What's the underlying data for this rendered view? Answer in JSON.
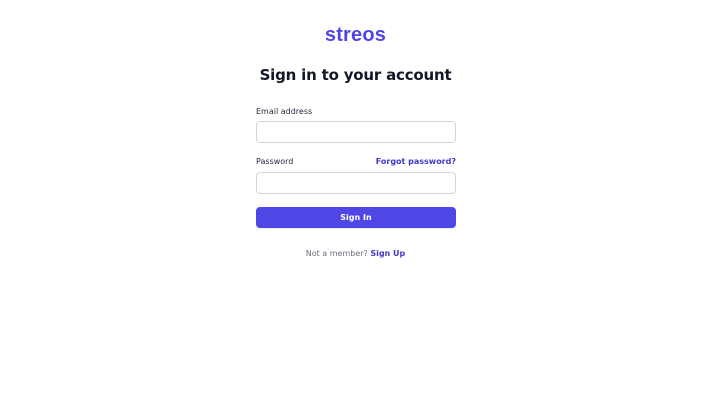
{
  "brand": {
    "name": "streos"
  },
  "heading": {
    "title": "Sign in to your account"
  },
  "form": {
    "email_label": "Email address",
    "email_value": "",
    "email_placeholder": "",
    "password_label": "Password",
    "password_value": "",
    "password_placeholder": "",
    "forgot_link": "Forgot password?",
    "submit_label": "Sign In"
  },
  "footer": {
    "prompt": "Not a member?",
    "signup_link": "Sign Up"
  },
  "colors": {
    "brand": "#5046e5",
    "accent": "#4f46e5",
    "link": "#4338ca",
    "input_border": "#d1d5db",
    "text_muted": "#6b7280"
  }
}
